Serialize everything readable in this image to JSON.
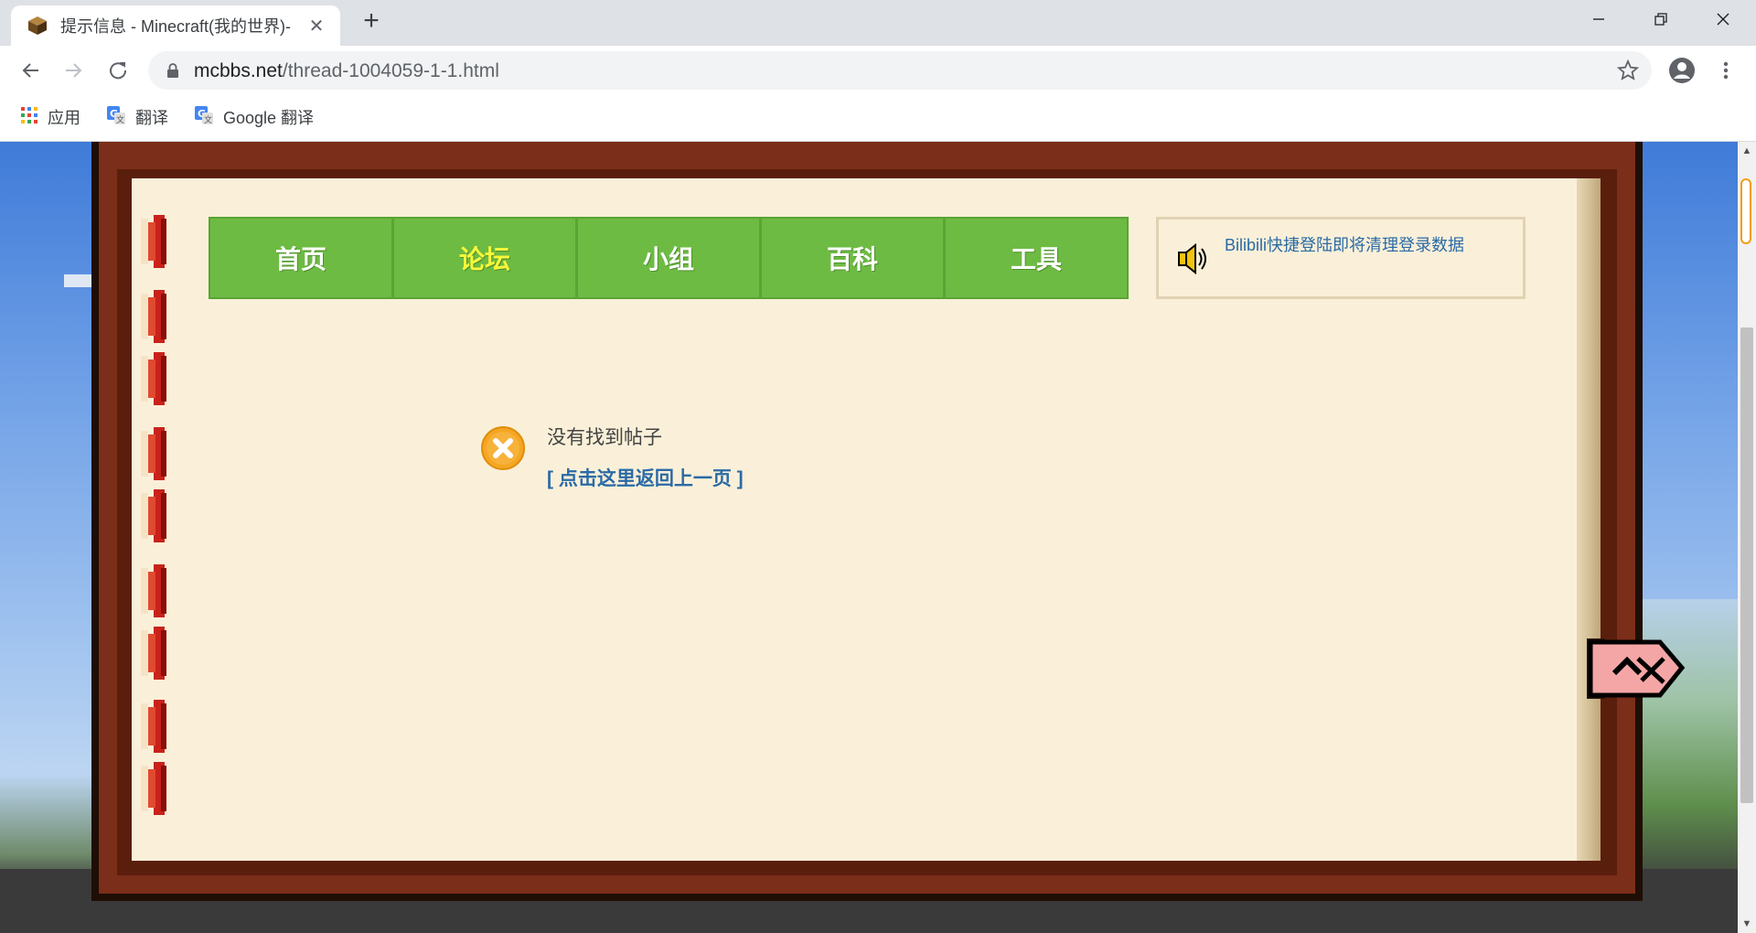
{
  "browser": {
    "tab_title": "提示信息 - Minecraft(我的世界)-",
    "tab_close": "✕",
    "new_tab": "+",
    "url_host": "mcbbs.net",
    "url_path": "/thread-1004059-1-1.html",
    "bookmarks": [
      {
        "label": "应用",
        "icon": "apps-grid-icon"
      },
      {
        "label": "翻译",
        "icon": "google-translate-icon"
      },
      {
        "label": "Google 翻译",
        "icon": "google-translate-icon"
      }
    ]
  },
  "site": {
    "nav": [
      {
        "label": "首页",
        "active": false
      },
      {
        "label": "论坛",
        "active": true
      },
      {
        "label": "小组",
        "active": false
      },
      {
        "label": "百科",
        "active": false
      },
      {
        "label": "工具",
        "active": false
      }
    ],
    "notice_text": "Bilibili快捷登陆即将清理登录数据",
    "message": {
      "title": "没有找到帖子",
      "back_link": "[ 点击这里返回上一页 ]"
    }
  },
  "colors": {
    "nav_green": "#6dbb43",
    "nav_active": "#f7f73a",
    "link_blue": "#2b6aa6",
    "book_brown": "#7b2e19",
    "page_cream": "#faf0d9"
  }
}
